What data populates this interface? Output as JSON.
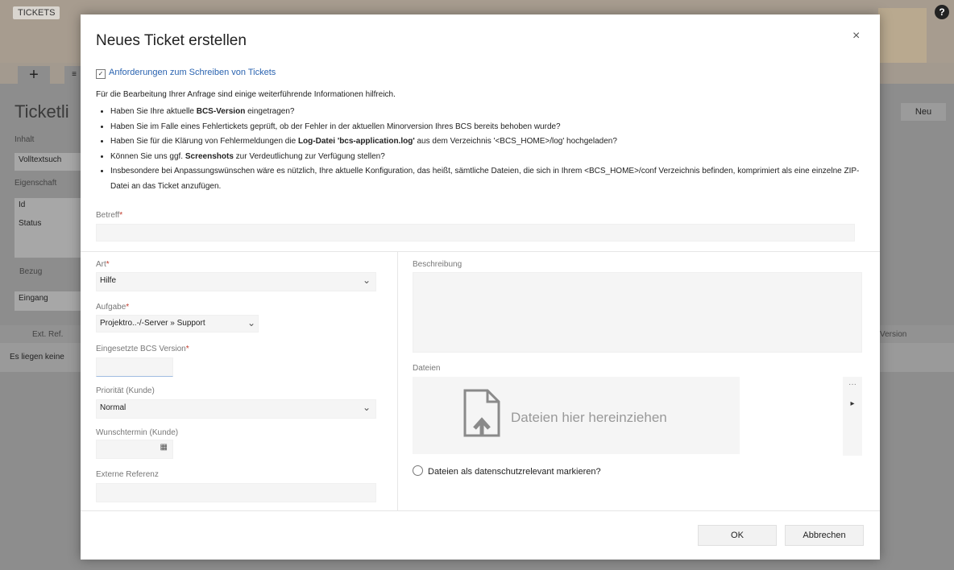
{
  "background": {
    "brand": "TICKETS",
    "page_title": "Ticketli",
    "new_button": "Neu",
    "labels": {
      "inhalt": "Inhalt",
      "volltextsuche": "Volltextsuch",
      "eigenschaften": "Eigenschaft",
      "id": "Id",
      "status": "Status",
      "bezug": "Bezug",
      "eingang": "Eingang",
      "ext_ref": "Ext. Ref.",
      "version": "Version",
      "empty_row": "Es liegen keine"
    }
  },
  "dialog": {
    "title": "Neues Ticket erstellen",
    "close": "×",
    "requirements_link": "Anforderungen zum Schreiben von Tickets",
    "intro": "Für die Bearbeitung Ihrer Anfrage sind einige weiterführende Informationen hilfreich.",
    "checklist": [
      [
        "Haben Sie Ihre aktuelle ",
        "BCS-Version",
        " eingetragen?"
      ],
      [
        "Haben Sie im Falle eines Fehlertickets geprüft, ob der Fehler in der aktuellen Minorversion Ihres BCS bereits behoben wurde?",
        "",
        ""
      ],
      [
        "Haben Sie für die Klärung von Fehlermeldungen die ",
        "Log-Datei 'bcs-application.log'",
        " aus dem Verzeichnis '<BCS_HOME>/log' hochgeladen?"
      ],
      [
        "Können Sie uns ggf. ",
        "Screenshots",
        " zur Verdeutlichung zur Verfügung stellen?"
      ],
      [
        "Insbesondere bei Anpassungswünschen wäre es nützlich, Ihre aktuelle Konfiguration, das heißt, sämtliche Dateien, die sich in Ihrem <BCS_HOME>/conf Verzeichnis befinden, komprimiert als eine einzelne ZIP-Datei an das Ticket anzufügen.",
        "",
        ""
      ]
    ],
    "fields": {
      "betreff_label": "Betreff",
      "art_label": "Art",
      "art_value": "Hilfe",
      "aufgabe_label": "Aufgabe",
      "aufgabe_value": "Projektro..-/-Server » Support",
      "version_label": "Eingesetzte BCS Version",
      "version_value": "",
      "prioritaet_label": "Priorität (Kunde)",
      "prioritaet_value": "Normal",
      "wunschtermin_label": "Wunschtermin (Kunde)",
      "externe_label": "Externe Referenz",
      "beschreibung_label": "Beschreibung",
      "dateien_label": "Dateien",
      "dropzone_text": "Dateien hier hereinziehen",
      "privacy_label": "Dateien als datenschutzrelevant markieren?"
    },
    "buttons": {
      "ok": "OK",
      "cancel": "Abbrechen"
    }
  }
}
